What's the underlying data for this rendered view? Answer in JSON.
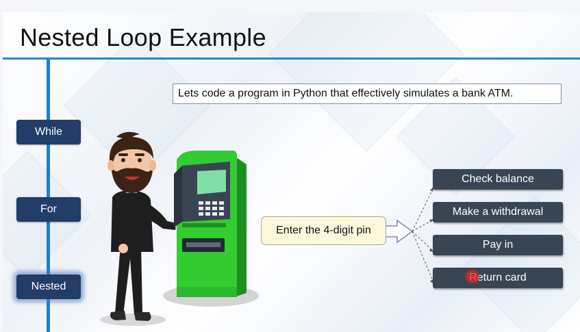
{
  "slide": {
    "title": "Nested Loop Example",
    "intro_text": "Lets code a program in Python that effectively simulates a bank ATM.",
    "loop_types": [
      "While",
      "For",
      "Nested"
    ],
    "active_loop_type": "Nested",
    "pin_prompt": "Enter the 4-digit pin",
    "atm_options": [
      "Check balance",
      "Make a withdrawal",
      "Pay in",
      "Return card"
    ]
  },
  "colors": {
    "accent_blue": "#1f86d6",
    "side_button": "#213d68",
    "option_button": "#3a4553",
    "atm_green": "#33cc33",
    "pin_box": "#fdf7dc"
  },
  "icons": [
    "person-illustration",
    "atm-machine-illustration",
    "block-arrow-icon",
    "cursor-highlight"
  ]
}
